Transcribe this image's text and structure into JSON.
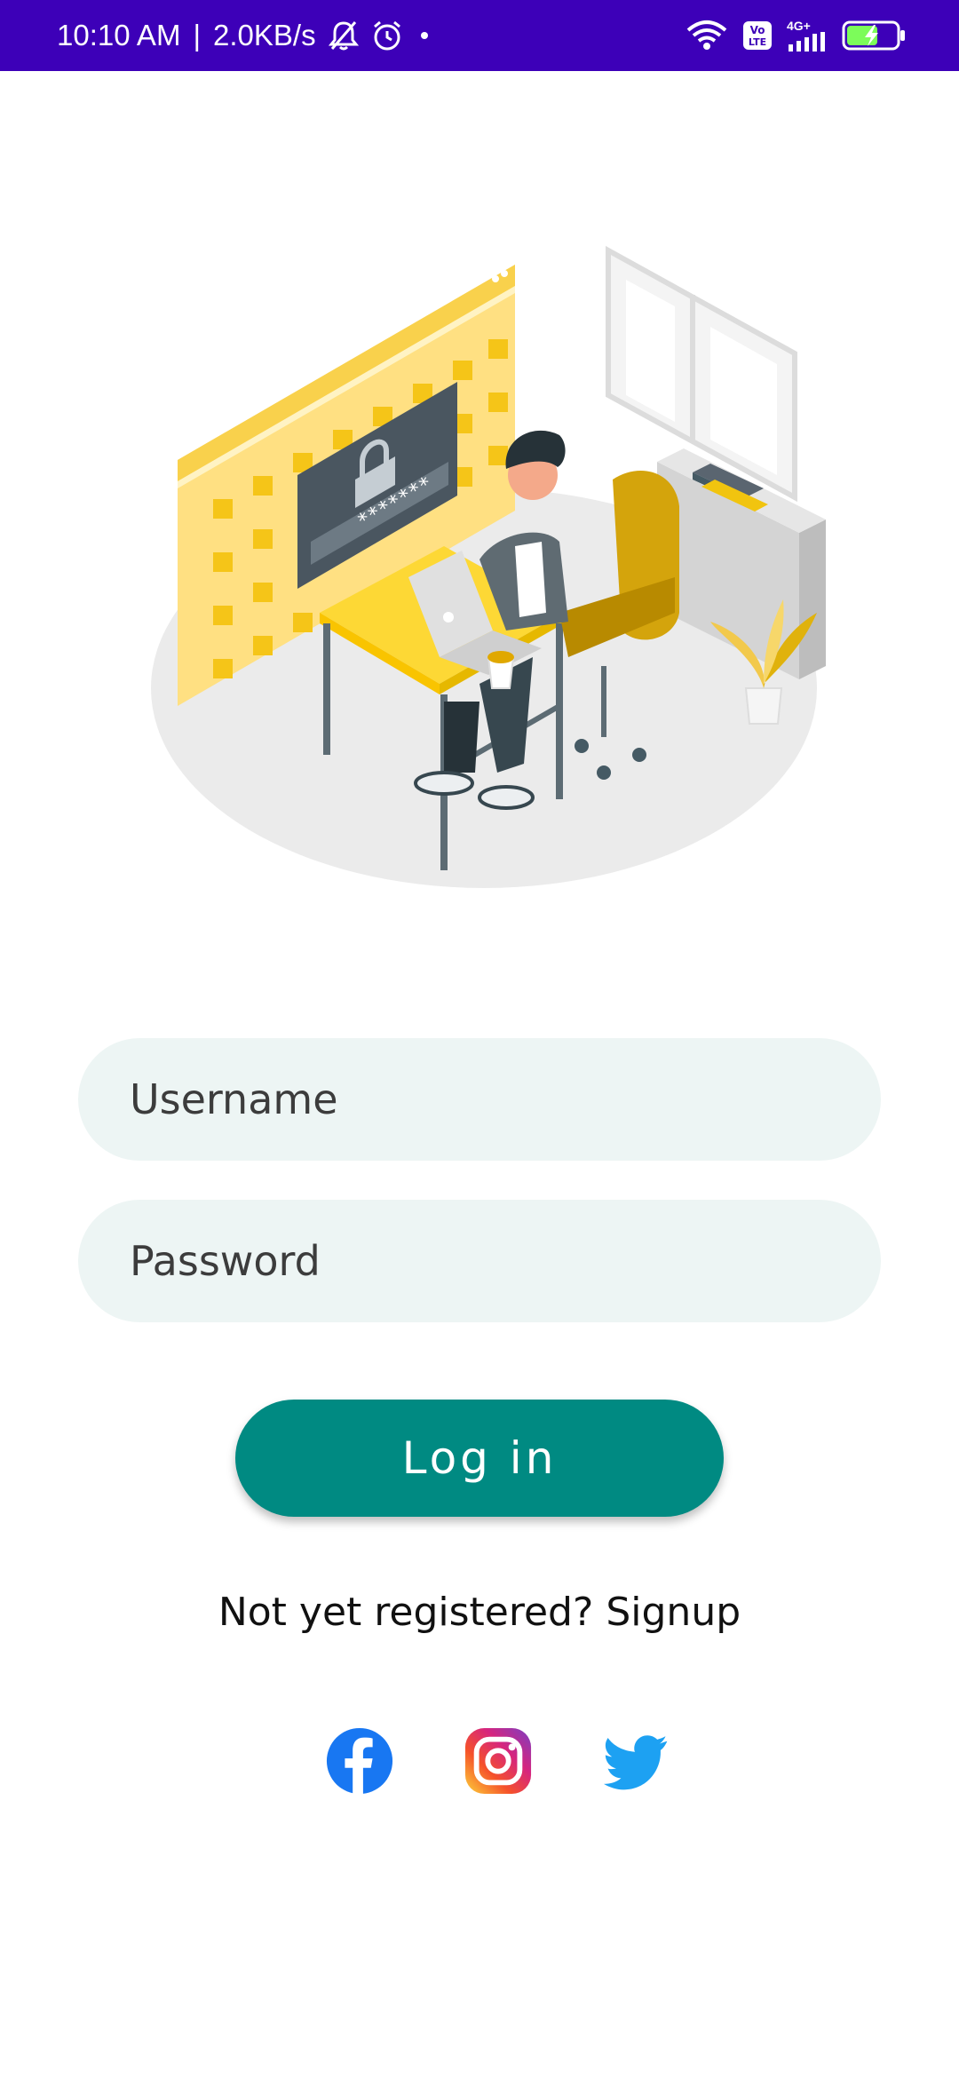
{
  "status_bar": {
    "time": "10:10 AM",
    "separator": "|",
    "speed": "2.0KB/s",
    "network": "4G+",
    "volte": "Vo LTE",
    "battery_color": "#7CFC5A"
  },
  "colors": {
    "status_bar": "#3d00b8",
    "accent": "#008a82",
    "field_bg": "#edf5f4"
  },
  "form": {
    "username_placeholder": "Username",
    "password_placeholder": "Password",
    "login_label": "Log in"
  },
  "signup": {
    "prompt": "Not yet registered?",
    "link_label": "Signup"
  },
  "socials": [
    {
      "icon": "facebook-icon"
    },
    {
      "icon": "instagram-icon"
    },
    {
      "icon": "twitter-icon"
    }
  ]
}
